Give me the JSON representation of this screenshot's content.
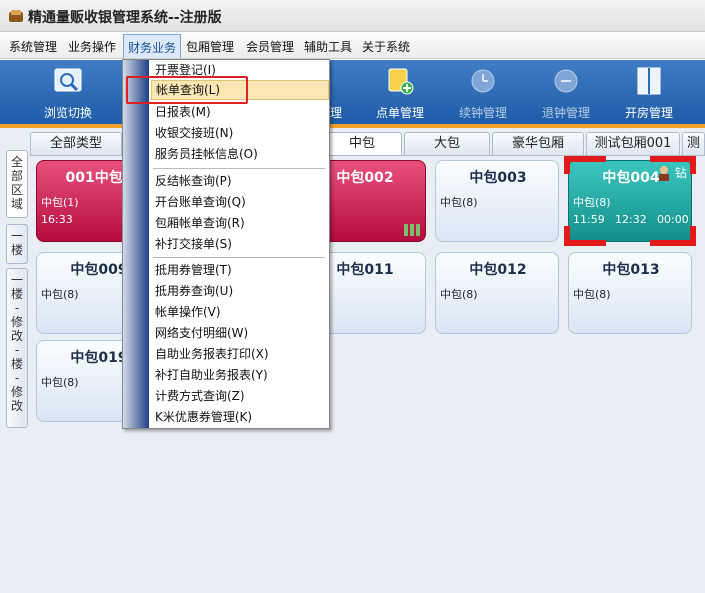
{
  "window": {
    "title": "精通量贩收银管理系统--注册版"
  },
  "menubar": {
    "items": [
      "系统管理",
      "业务操作",
      "财务业务",
      "包厢管理",
      "会员管理",
      "辅助工具",
      "关于系统"
    ]
  },
  "toolbar": {
    "browse_label": "浏览切换",
    "bill_label": "单管理",
    "order_label": "点单管理",
    "renew_label": "续钟管理",
    "return_label": "退钟管理",
    "open_label": "开房管理"
  },
  "left_rail": {
    "tab1": [
      "全",
      "部",
      "区",
      "域"
    ],
    "tab2": [
      "一",
      "楼"
    ],
    "tab3": [
      "一",
      "楼",
      "-",
      "修",
      "改",
      "-",
      "楼",
      "-",
      "修",
      "改"
    ]
  },
  "tabs": [
    "全部类型",
    "中包",
    "大包",
    "豪华包厢",
    "测试包厢001",
    "测"
  ],
  "rooms": [
    {
      "name": "001中包0",
      "type": "中包(1)",
      "time": "16:33"
    },
    {
      "name": "中包002",
      "type": "(0)",
      "time": "0"
    },
    {
      "name": "中包003",
      "type": "中包(8)"
    },
    {
      "name": "中包004",
      "type": "中包(8)",
      "start": "11:59",
      "end": "12:32",
      "elapsed": "00:00",
      "vip": "钻"
    },
    {
      "name": "中包009",
      "type": "中包(8)"
    },
    {
      "name": "中包011",
      "type": "(8)"
    },
    {
      "name": "中包012",
      "type": "中包(8)"
    },
    {
      "name": "中包013",
      "type": "中包(8)"
    },
    {
      "name": "中包019",
      "type": "中包(8)"
    }
  ],
  "finance_menu": {
    "items": [
      "开票登记(I)",
      "帐单查询(L)",
      "日报表(M)",
      "收银交接班(N)",
      "服务员挂帐信息(O)",
      "反结帐查询(P)",
      "开台账单查询(Q)",
      "包厢帐单查询(R)",
      "补打交接单(S)",
      "抵用券管理(T)",
      "抵用券查询(U)",
      "帐单操作(V)",
      "网络支付明细(W)",
      "自助业务报表打印(X)",
      "补打自助业务报表(Y)",
      "计费方式查询(Z)",
      "K米优惠券管理(K)"
    ],
    "highlighted_index": 1
  },
  "colors": {
    "toolbar_blue": "#2a6cb8",
    "accent_orange": "#f3a22a",
    "occupied_red": "#c8124a",
    "active_teal": "#1aa8a2",
    "highlight_outline": "#e02020"
  }
}
